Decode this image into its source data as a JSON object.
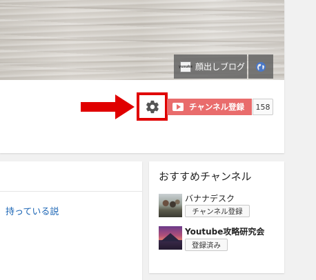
{
  "banner": {
    "blog_link_label": "顔出しブログ",
    "blog_favicon_text": "yusuke",
    "globe_icon": "globe-icon"
  },
  "channel_actions": {
    "settings_icon": "gear-icon",
    "subscribe_label": "チャンネル登録",
    "subscriber_count": "158"
  },
  "content": {
    "video_title_fragment": "持っている説"
  },
  "recommended": {
    "title": "おすすめチャンネル",
    "channels": [
      {
        "name": "バナナデスク",
        "button_label": "チャンネル登録"
      },
      {
        "name": "Youtube攻略研究会",
        "button_label": "登録済み"
      }
    ]
  },
  "colors": {
    "annotation_red": "#e00000",
    "subscribe_red": "#e96c6c",
    "link_blue": "#1a64b4"
  }
}
